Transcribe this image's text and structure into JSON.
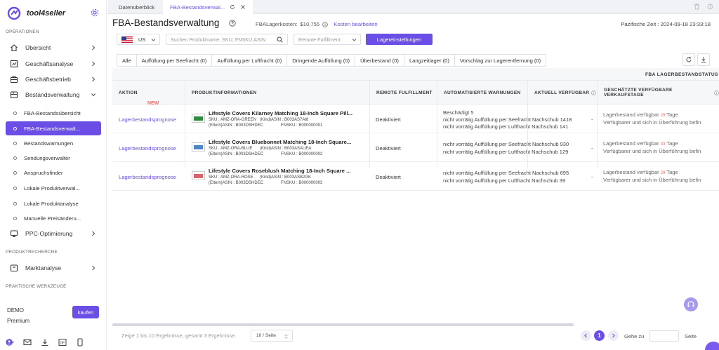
{
  "app": {
    "name": "tool4seller"
  },
  "sidebar": {
    "sections": {
      "operationen": "OPERATIONEN",
      "produktrecherche": "PRODUKTRECHERCHE",
      "werkzeuge": "PRAKTISCHE WERKZEUGE"
    },
    "items": {
      "uebersicht": "Übersicht",
      "geschaeftsanalyse": "Geschäftsanalyse",
      "geschaeftsbetrieb": "Geschäftsbetrieb",
      "bestandsverwaltung": "Bestandsverwaltung",
      "ppc": "PPC-Optimierung",
      "marktanalyse": "Marktanalyse"
    },
    "subitems": [
      "FBA-Bestandsübersicht",
      "FBA-Bestandsverwalt...",
      "Bestandswarnungen",
      "Sendungsverwalter",
      "Anspruchsfinder",
      "Lokale Produktverwal...",
      "Lokale Produktanalyse",
      "Manuelle Preisänderu..."
    ],
    "account": {
      "plan": "DEMO",
      "tier": "Premium",
      "buy_label": "kaufen"
    }
  },
  "tabs": [
    "Datenüberblick",
    "FBA-Bestandsverwal..."
  ],
  "header": {
    "title": "FBA-Bestandsverwaltung",
    "cost_label": "FBALagerkosten:",
    "cost_value": "$10,755",
    "cost_edit": "Kosten bearbeiten",
    "time": "Pazifische Zeit : 2024-09-18 23:33:18"
  },
  "toolbar": {
    "country": "US",
    "search_placeholder": "Suchen Produktname, SKU, FNSKU,ASIN",
    "fulfillment_placeholder": "Remote Fulfillment",
    "settings_label": "Lagereinstellungen"
  },
  "filters": [
    "Alle",
    "Auffüllung per Seefracht (0)",
    "Auffüllung per Luftfracht (0)",
    "Dringende Auffüllung (0)",
    "Überbestand (0)",
    "Langzeitlager (0)",
    "Vorschlag zur Lagerentfernung (0)"
  ],
  "table": {
    "group_header": "FBA LAGERBESTANDSTATUS",
    "columns": [
      "AKTION",
      "PRODUKTINFORMATIONEN",
      "REMOTE FULFILLMENT",
      "AUTOMATISIERTE WARNUNGEN",
      "AKTUELL VERFÜGBAR",
      "GESCHÄTZTE VERFÜGBARE VERKAUFSTAGE"
    ],
    "rows": [
      {
        "action": "Lagerbestandsprognose",
        "badge": "NEW",
        "title": "Lifestyle Covers Kilarney Matching 18-Inch Square Pill...",
        "sku": "SKU : AMZ-ORA-GREEN",
        "asin": "(Kind)ASIN : B003AS7AI8",
        "parent": "(Eltern)ASIN : B003DSHDEC",
        "fnsku": "FNSKU : B000000001",
        "remote": "Deaktiviert",
        "warnings": [
          "Beschädigt 5",
          "nicht vorrätig Auffüllung per Seefracht Nachschub 1418",
          "nicht vorrätig Auffüllung per Luftfracht Nachschub 141"
        ],
        "available": "-",
        "est_line1": "Lagerbestand verfügbar",
        "est_days": "29",
        "est_unit": "Tage",
        "est_line2": "Verfügbarer und sich in Überführung befin",
        "thumb_color": "#2e8b3e"
      },
      {
        "action": "Lagerbestandsprognose",
        "badge": "",
        "title": "Lifestyle Covers Bluebonnet Matching 18-Inch Square...",
        "sku": "SKU : AMZ-ORA-BLUE",
        "asin": "(Kind)ASIN : B003ASAUEA",
        "parent": "(Eltern)ASIN : B003DSHDEC",
        "fnsku": "FNSKU : B000000002",
        "remote": "Deaktiviert",
        "warnings": [
          "nicht vorrätig Auffüllung per Seefracht Nachschub 930",
          "nicht vorrätig Auffüllung per Luftfracht Nachschub 129"
        ],
        "available": "-",
        "est_line1": "Lagerbestand verfügbar",
        "est_days": "33",
        "est_unit": "Tage",
        "est_line2": "Verfügbarer und sich in Überführung befin",
        "thumb_color": "#4a86c8"
      },
      {
        "action": "Lagerbestandsprognose",
        "badge": "",
        "title": "Lifestyle Covers Roseblush Matching 18-Inch Square ...",
        "sku": "SKU : AMZ-ORA-ROSE",
        "asin": "(Kind)ASIN : B003ASB2GK",
        "parent": "(Eltern)ASIN : B003DSHDEC",
        "fnsku": "FNSKU : B000000003",
        "remote": "Deaktiviert",
        "warnings": [
          "nicht vorrätig Auffüllung per Seefracht Nachschub 695",
          "nicht vorrätig Auffüllung per Luftfracht Nachschub 39"
        ],
        "available": "-",
        "est_line1": "Lagerbestand verfügbar",
        "est_days": "29",
        "est_unit": "Tage",
        "est_line2": "Verfügbarer und sich in Überführung befin",
        "thumb_color": "#d9646e"
      }
    ]
  },
  "pagination": {
    "summary": "Zeige 1 bis 10 Ergebnisse, gesamt 3 Ergebnisse.",
    "per_page": "10 / Seite",
    "current": "1",
    "goto_label": "Gehe zu",
    "page_label": "Seite"
  },
  "colors": {
    "accent": "#6b4ee6",
    "badge": "#f06b6b"
  }
}
